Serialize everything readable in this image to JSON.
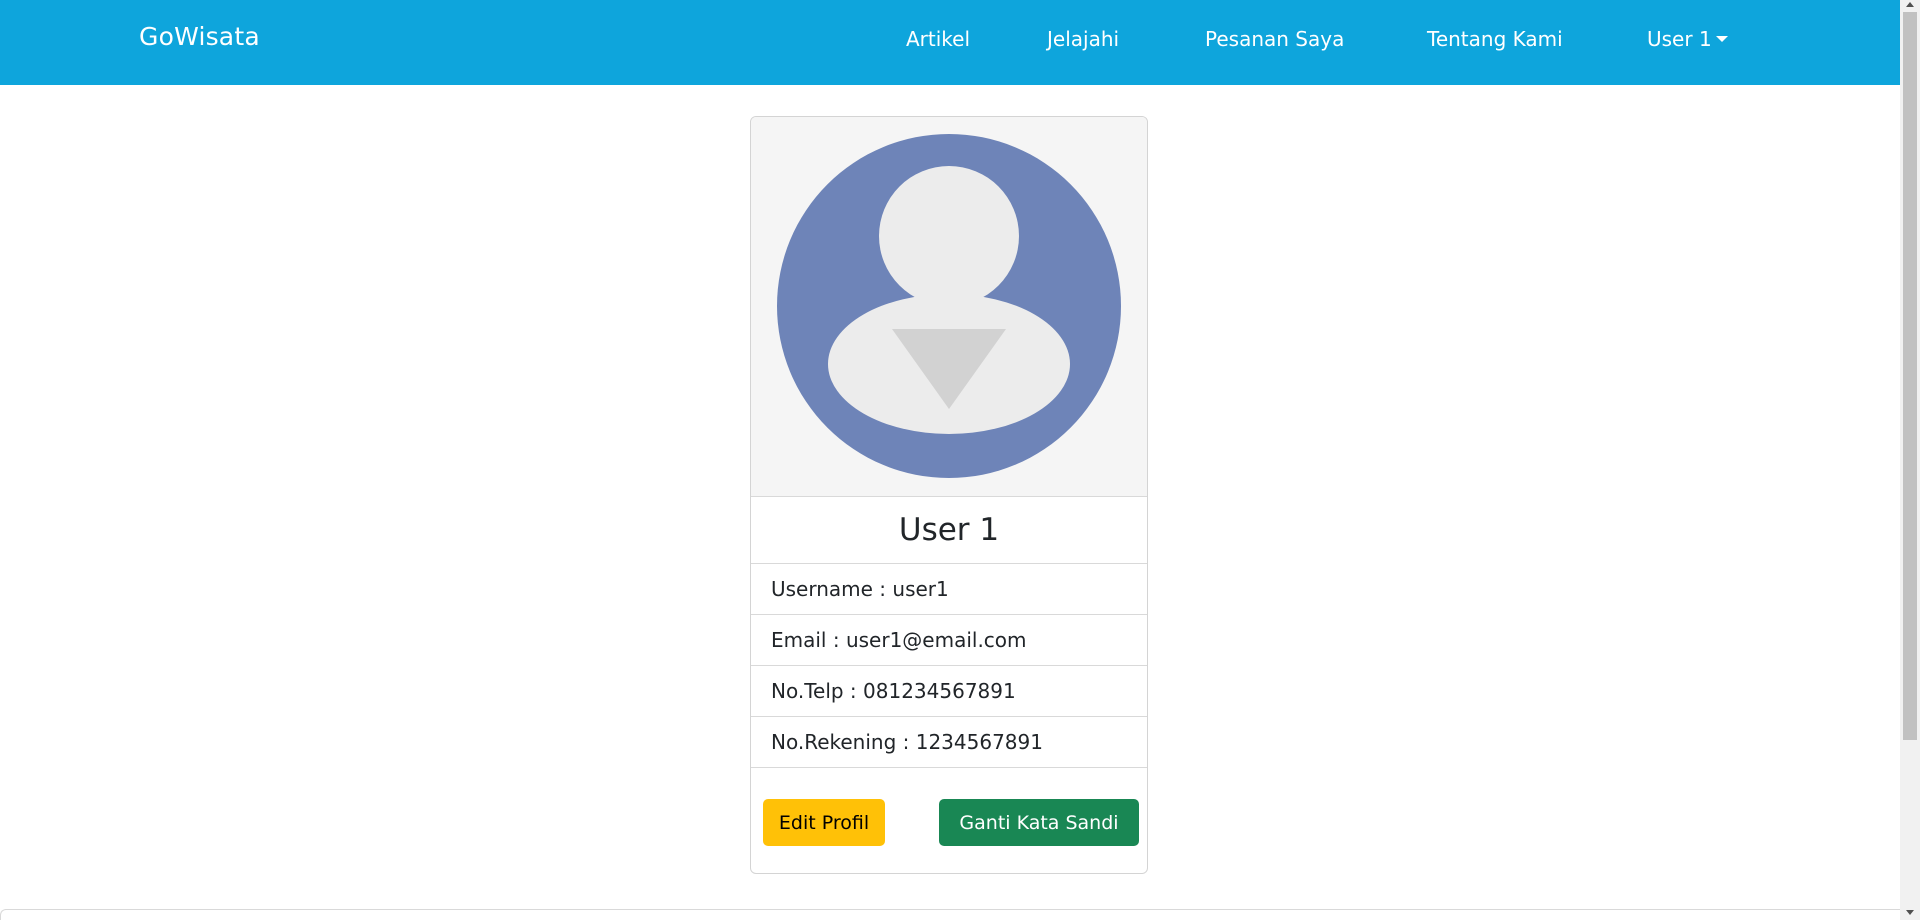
{
  "navbar": {
    "brand": "GoWisata",
    "bg_color": "#0ea5dc",
    "links": [
      {
        "label": "Artikel"
      },
      {
        "label": "Jelajahi"
      },
      {
        "label": "Pesanan Saya"
      },
      {
        "label": "Tentang Kami"
      }
    ],
    "user_menu": {
      "label": "User 1",
      "icon": "caret-down-icon"
    }
  },
  "profile": {
    "avatar_icon": "user-avatar-icon",
    "name": "User 1",
    "fields": [
      {
        "text": "Username : user1"
      },
      {
        "text": "Email : user1@email.com"
      },
      {
        "text": "No.Telp : 081234567891"
      },
      {
        "text": "No.Rekening : 1234567891"
      }
    ],
    "buttons": {
      "edit_label": "Edit Profil",
      "edit_color": "#ffc107",
      "password_label": "Ganti Kata Sandi",
      "password_color": "#198754"
    }
  }
}
